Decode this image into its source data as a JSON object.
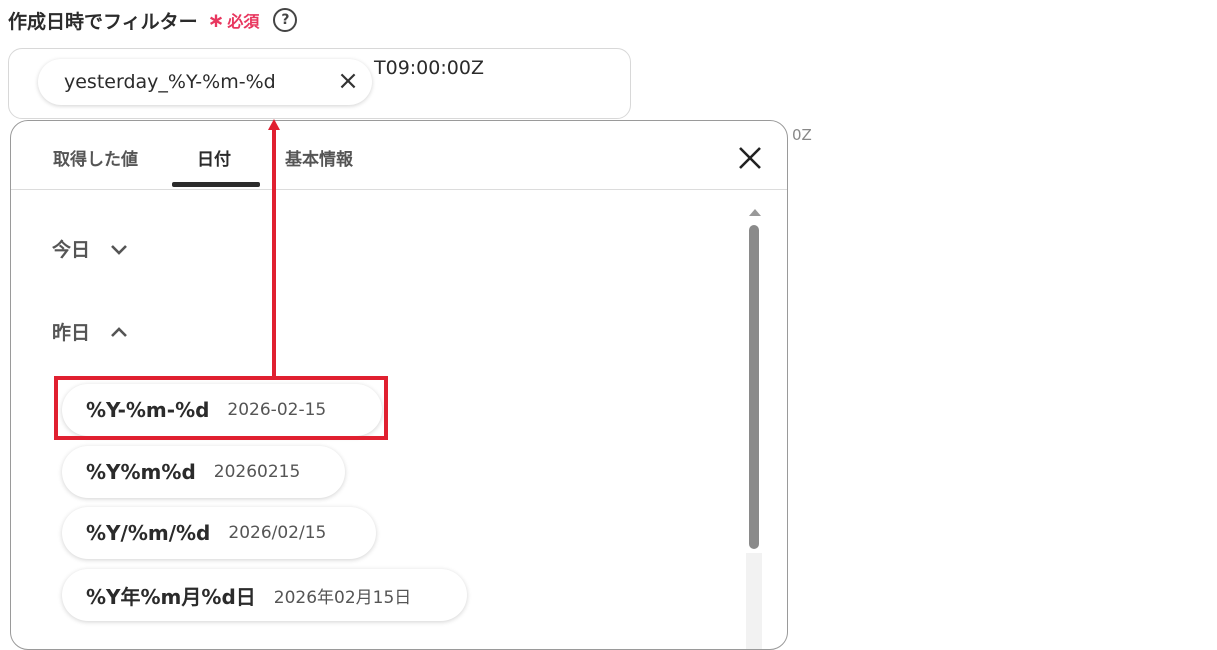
{
  "field": {
    "label": "作成日時でフィルター",
    "required_mark": "∗",
    "required_text": "必須",
    "help_glyph": "?"
  },
  "input": {
    "chip_text": "yesterday_%Y-%m-%d",
    "chip_close_glyph": "×",
    "suffix_text": "T09:00:00Z"
  },
  "background": {
    "partial_text": "0Z"
  },
  "popup": {
    "tabs": [
      {
        "label": "取得した値",
        "active": false
      },
      {
        "label": "日付",
        "active": true
      },
      {
        "label": "基本情報",
        "active": false
      }
    ],
    "close_icon": "close-icon",
    "sections": [
      {
        "label": "今日",
        "expanded": false
      },
      {
        "label": "昨日",
        "expanded": true
      }
    ],
    "formats": [
      {
        "format": "%Y-%m-%d",
        "example": "2026-02-15"
      },
      {
        "format": "%Y%m%d",
        "example": "20260215"
      },
      {
        "format": "%Y/%m/%d",
        "example": "2026/02/15"
      },
      {
        "format": "%Y年%m月%d日",
        "example": "2026年02月15日"
      }
    ]
  },
  "colors": {
    "required": "#e8375f",
    "annotation": "#e02030"
  }
}
